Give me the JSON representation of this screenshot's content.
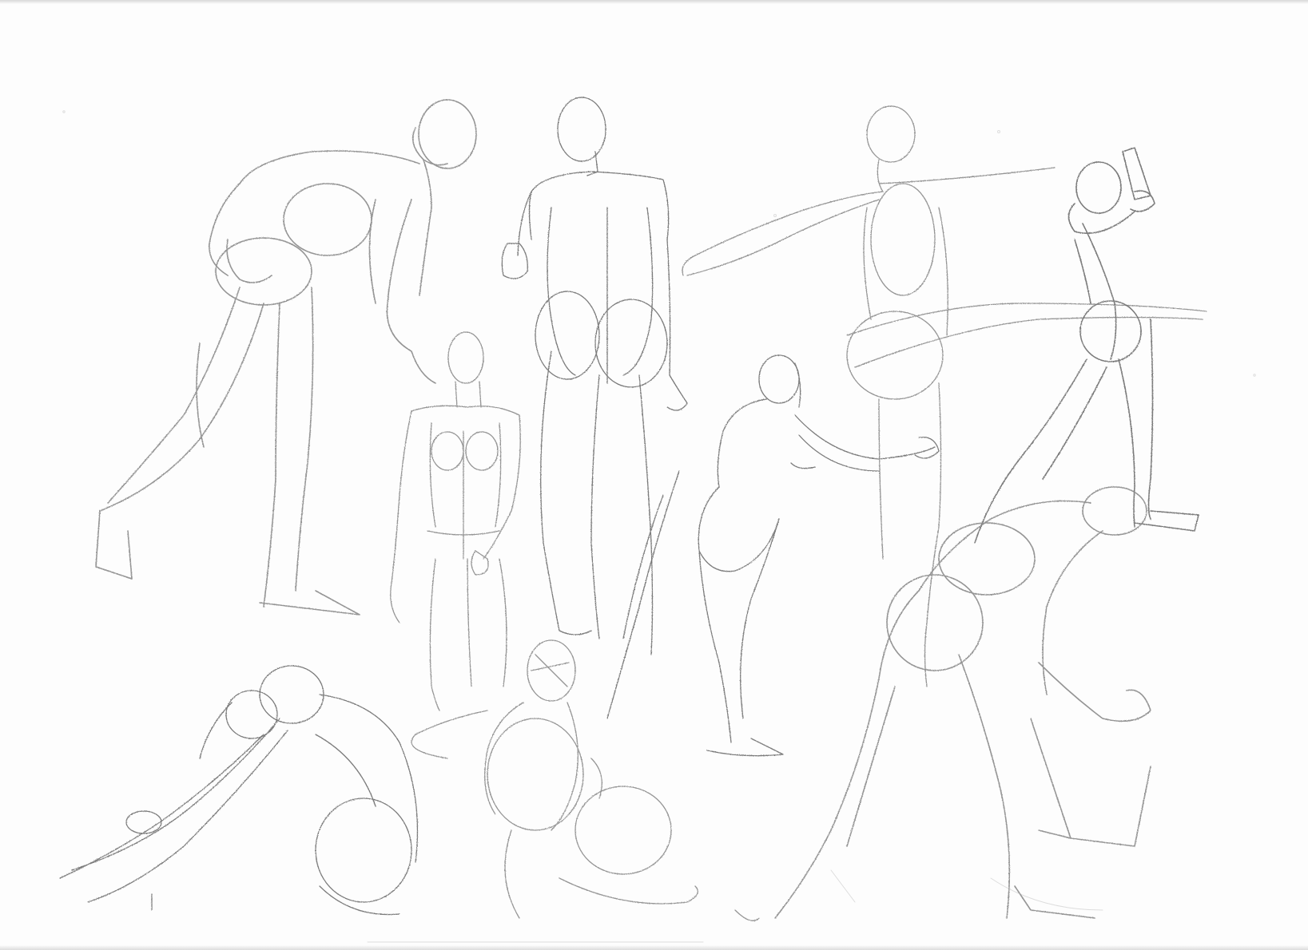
{
  "image": {
    "kind": "pencil-gesture-sketch-sheet",
    "paper_color": "#fdfdfd",
    "pencil_color": "#8a8a8a",
    "pencil_dark": "#6e6e6e",
    "pencil_light": "#b5b5b5"
  },
  "figures": [
    {
      "id": "bending-figure"
    },
    {
      "id": "back-view-figure"
    },
    {
      "id": "reaching-figure"
    },
    {
      "id": "camera-figure"
    },
    {
      "id": "front-standing-figure"
    },
    {
      "id": "leaning-push-figure"
    },
    {
      "id": "crouching-figure"
    },
    {
      "id": "reclining-figure"
    },
    {
      "id": "kneeling-figure"
    }
  ]
}
